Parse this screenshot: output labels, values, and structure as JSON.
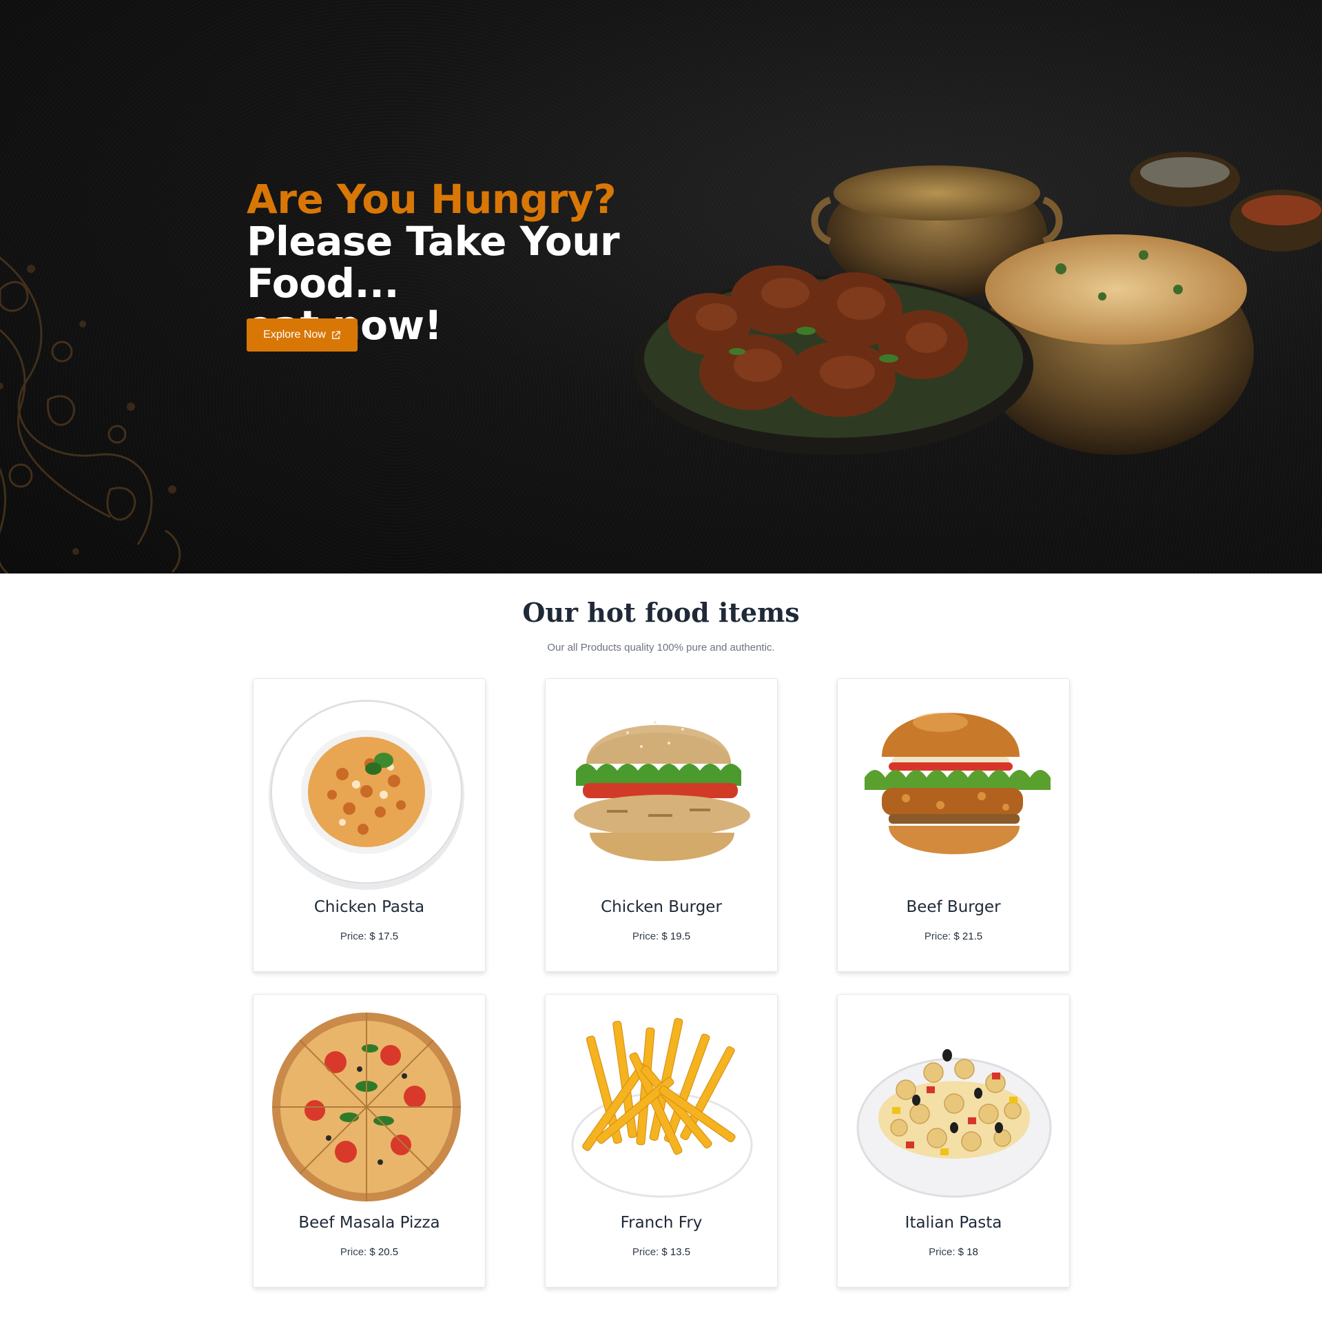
{
  "hero": {
    "kicker": "Are You Hungry?",
    "title_line1": "Please Take Your Food...",
    "title_line2": "eat now!",
    "button_label": "Explore Now",
    "accent_color": "#d97706"
  },
  "menu": {
    "title": "Our hot food items",
    "subtitle": "Our all Products quality 100% pure and authentic.",
    "price_label": "Price:",
    "items": [
      {
        "name": "Chicken Pasta",
        "price": "$ 17.5",
        "image": "chicken-pasta-image"
      },
      {
        "name": "Chicken Burger",
        "price": "$ 19.5",
        "image": "chicken-burger-image"
      },
      {
        "name": "Beef Burger",
        "price": "$ 21.5",
        "image": "beef-burger-image"
      },
      {
        "name": "Beef Masala Pizza",
        "price": "$ 20.5",
        "image": "pizza-image"
      },
      {
        "name": "Franch Fry",
        "price": "$ 13.5",
        "image": "french-fries-image"
      },
      {
        "name": "Italian Pasta",
        "price": "$ 18",
        "image": "italian-pasta-image"
      }
    ]
  }
}
